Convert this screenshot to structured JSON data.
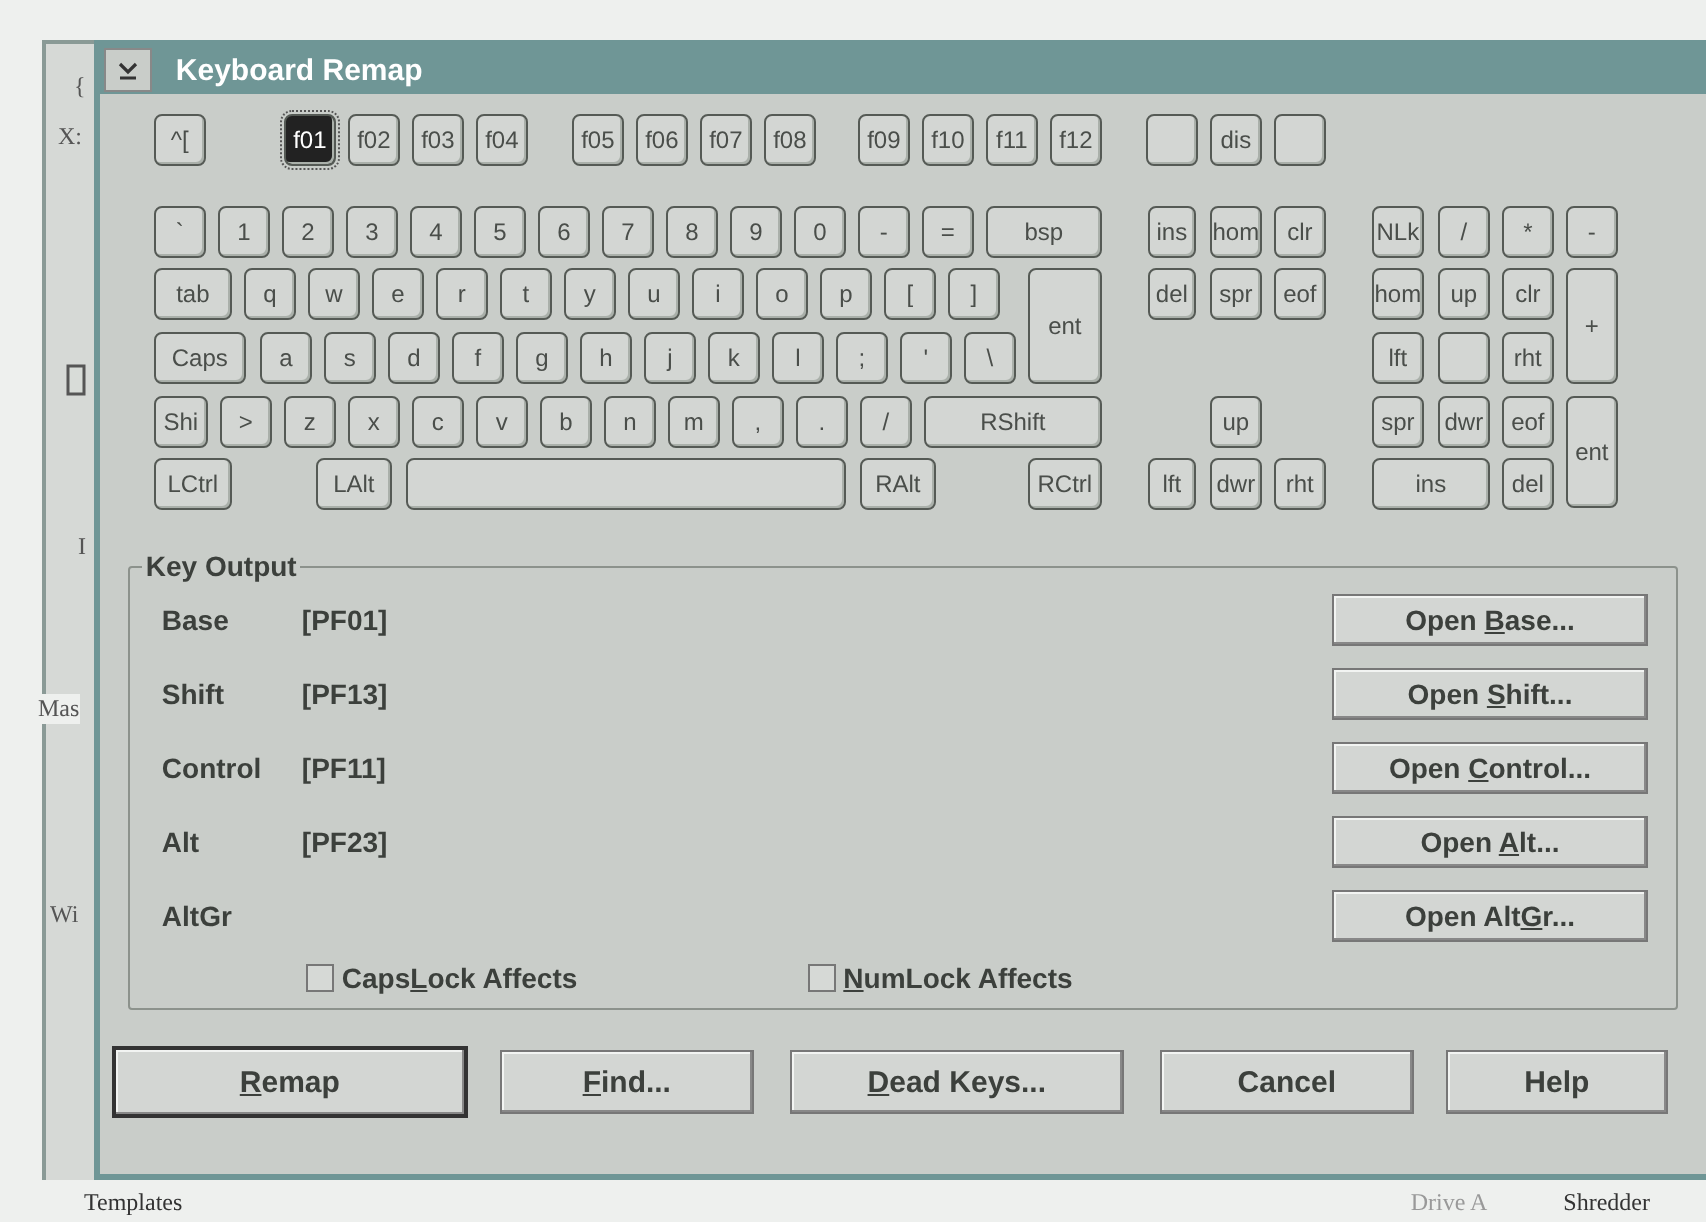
{
  "background_window": {
    "texts": [
      "{",
      "X:",
      "I",
      "Mas",
      "Wi"
    ]
  },
  "dialog": {
    "title": "Keyboard Remap",
    "keys": [
      {
        "label": "^[",
        "selected": false
      },
      {
        "label": "f01",
        "selected": true
      },
      {
        "label": "f02",
        "selected": false
      },
      {
        "label": "f03",
        "selected": false
      },
      {
        "label": "f04",
        "selected": false
      },
      {
        "label": "f05",
        "selected": false
      },
      {
        "label": "f06",
        "selected": false
      },
      {
        "label": "f07",
        "selected": false
      },
      {
        "label": "f08",
        "selected": false
      },
      {
        "label": "f09",
        "selected": false
      },
      {
        "label": "f10",
        "selected": false
      },
      {
        "label": "f11",
        "selected": false
      },
      {
        "label": "f12",
        "selected": false
      },
      {
        "selected": false
      },
      {
        "label": "dis",
        "selected": false
      },
      {
        "selected": false
      },
      {
        "label": "`",
        "selected": false
      },
      {
        "label": "1",
        "selected": false
      },
      {
        "label": "2",
        "selected": false
      },
      {
        "label": "3",
        "selected": false
      },
      {
        "label": "4",
        "selected": false
      },
      {
        "label": "5",
        "selected": false
      },
      {
        "label": "6",
        "selected": false
      },
      {
        "label": "7",
        "selected": false
      },
      {
        "label": "8",
        "selected": false
      },
      {
        "label": "9",
        "selected": false
      },
      {
        "label": "0",
        "selected": false
      },
      {
        "label": "-",
        "selected": false
      },
      {
        "label": "=",
        "selected": false
      },
      {
        "label": "bsp",
        "selected": false
      },
      {
        "label": "ins",
        "selected": false
      },
      {
        "label": "hom",
        "selected": false
      },
      {
        "label": "clr",
        "selected": false
      },
      {
        "label": "NLk",
        "selected": false
      },
      {
        "label": "/",
        "selected": false
      },
      {
        "label": "*",
        "selected": false
      },
      {
        "label": "-",
        "selected": false
      },
      {
        "label": "tab",
        "selected": false
      },
      {
        "label": "q",
        "selected": false
      },
      {
        "label": "w",
        "selected": false
      },
      {
        "label": "e",
        "selected": false
      },
      {
        "label": "r",
        "selected": false
      },
      {
        "label": "t",
        "selected": false
      },
      {
        "label": "y",
        "selected": false
      },
      {
        "label": "u",
        "selected": false
      },
      {
        "label": "i",
        "selected": false
      },
      {
        "label": "o",
        "selected": false
      },
      {
        "label": "p",
        "selected": false
      },
      {
        "label": "[",
        "selected": false
      },
      {
        "label": "]",
        "selected": false
      },
      {
        "label": "ent",
        "selected": false
      },
      {
        "label": "del",
        "selected": false
      },
      {
        "label": "spr",
        "selected": false
      },
      {
        "label": "eof",
        "selected": false
      },
      {
        "label": "hom",
        "selected": false
      },
      {
        "label": "up",
        "selected": false
      },
      {
        "label": "clr",
        "selected": false
      },
      {
        "label": "+",
        "selected": false
      },
      {
        "label": "Caps",
        "selected": false
      },
      {
        "label": "a",
        "selected": false
      },
      {
        "label": "s",
        "selected": false
      },
      {
        "label": "d",
        "selected": false
      },
      {
        "label": "f",
        "selected": false
      },
      {
        "label": "g",
        "selected": false
      },
      {
        "label": "h",
        "selected": false
      },
      {
        "label": "j",
        "selected": false
      },
      {
        "label": "k",
        "selected": false
      },
      {
        "label": "l",
        "selected": false
      },
      {
        "label": ";",
        "selected": false
      },
      {
        "label": "'",
        "selected": false
      },
      {
        "label": "\\",
        "selected": false
      },
      {
        "label": "lft",
        "selected": false
      },
      {
        "selected": false
      },
      {
        "label": "rht",
        "selected": false
      },
      {
        "label": "Shi",
        "selected": false
      },
      {
        "label": ">",
        "selected": false
      },
      {
        "label": "z",
        "selected": false
      },
      {
        "label": "x",
        "selected": false
      },
      {
        "label": "c",
        "selected": false
      },
      {
        "label": "v",
        "selected": false
      },
      {
        "label": "b",
        "selected": false
      },
      {
        "label": "n",
        "selected": false
      },
      {
        "label": "m",
        "selected": false
      },
      {
        "label": ",",
        "selected": false
      },
      {
        "label": ".",
        "selected": false
      },
      {
        "label": "/",
        "selected": false
      },
      {
        "label": "RShift",
        "selected": false
      },
      {
        "label": "up",
        "selected": false
      },
      {
        "label": "spr",
        "selected": false
      },
      {
        "label": "dwr",
        "selected": false
      },
      {
        "label": "eof",
        "selected": false
      },
      {
        "label": "ent",
        "selected": false
      },
      {
        "label": "LCtrl",
        "selected": false
      },
      {
        "label": "LAlt",
        "selected": false
      },
      {
        "selected": false
      },
      {
        "label": "RAlt",
        "selected": false
      },
      {
        "label": "RCtrl",
        "selected": false
      },
      {
        "label": "lft",
        "selected": false
      },
      {
        "label": "dwr",
        "selected": false
      },
      {
        "label": "rht",
        "selected": false
      },
      {
        "label": "ins",
        "selected": false
      },
      {
        "label": "del",
        "selected": false
      }
    ],
    "key_output": {
      "title": "Key Output",
      "rows": [
        {
          "label": "Base",
          "value": "[PF01]",
          "button": [
            {
              "text": "Open ",
              "underline": false
            },
            {
              "text": "B",
              "underline": true
            },
            {
              "text": "ase...",
              "underline": false
            }
          ]
        },
        {
          "label": "Shift",
          "value": "[PF13]",
          "button": [
            {
              "text": "Open ",
              "underline": false
            },
            {
              "text": "S",
              "underline": true
            },
            {
              "text": "hift...",
              "underline": false
            }
          ]
        },
        {
          "label": "Control",
          "value": "[PF11]",
          "button": [
            {
              "text": "Open ",
              "underline": false
            },
            {
              "text": "C",
              "underline": true
            },
            {
              "text": "ontrol...",
              "underline": false
            }
          ]
        },
        {
          "label": "Alt",
          "value": "[PF23]",
          "button": [
            {
              "text": "Open ",
              "underline": false
            },
            {
              "text": "A",
              "underline": true
            },
            {
              "text": "lt...",
              "underline": false
            }
          ]
        },
        {
          "label": "AltGr",
          "button": [
            {
              "text": "Open Alt",
              "underline": false
            },
            {
              "text": "G",
              "underline": true
            },
            {
              "text": "r...",
              "underline": false
            }
          ]
        }
      ],
      "checkboxes": [
        {
          "label": [
            {
              "text": "Caps",
              "underline": false
            },
            {
              "text": "L",
              "underline": true
            },
            {
              "text": "ock Affects",
              "underline": false
            }
          ],
          "checked": false
        },
        {
          "label": [
            {
              "text": "N",
              "underline": true
            },
            {
              "text": "umLock Affects",
              "underline": false
            }
          ],
          "checked": false
        }
      ]
    },
    "buttons": [
      {
        "label": [
          {
            "text": "R",
            "underline": true
          },
          {
            "text": "emap",
            "underline": false
          }
        ],
        "default": true
      },
      {
        "label": [
          {
            "text": "F",
            "underline": true
          },
          {
            "text": "ind...",
            "underline": false
          }
        ],
        "default": false
      },
      {
        "label": [
          {
            "text": "D",
            "underline": true
          },
          {
            "text": "ead Keys...",
            "underline": false
          }
        ],
        "default": false
      },
      {
        "label": [
          {
            "text": "Cancel",
            "underline": false
          }
        ],
        "default": false
      },
      {
        "label": [
          {
            "text": "Help",
            "underline": false
          }
        ],
        "default": false
      }
    ]
  },
  "desktop_labels": [
    {
      "label": "Templates",
      "disabled": false
    },
    {
      "label": "Drive A",
      "disabled": true
    },
    {
      "label": "Shredder",
      "disabled": false
    }
  ]
}
